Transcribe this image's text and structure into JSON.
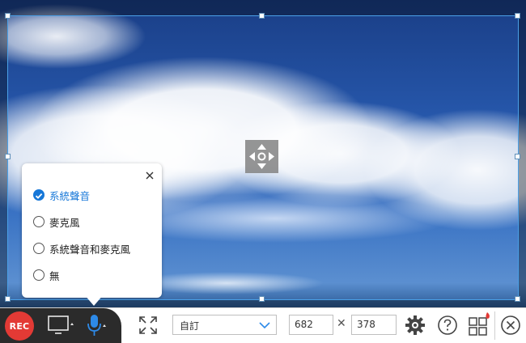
{
  "audio_menu": {
    "options": [
      {
        "label": "系統聲音",
        "selected": true
      },
      {
        "label": "麥克風",
        "selected": false
      },
      {
        "label": "系統聲音和麥克風",
        "selected": false
      },
      {
        "label": "無",
        "selected": false
      }
    ]
  },
  "toolbar": {
    "rec_label": "REC",
    "preset_value": "自訂",
    "width_value": "682",
    "height_value": "378",
    "times_symbol": "✕"
  },
  "colors": {
    "accent": "#1677d8",
    "rec": "#e33a35",
    "frame": "#4aa0e8"
  },
  "icons": [
    "move-icon",
    "close-icon",
    "check-icon",
    "monitor-icon",
    "microphone-icon",
    "fullscreen-icon",
    "chevron-down-icon",
    "gear-icon",
    "help-icon",
    "apps-icon",
    "exit-icon"
  ]
}
